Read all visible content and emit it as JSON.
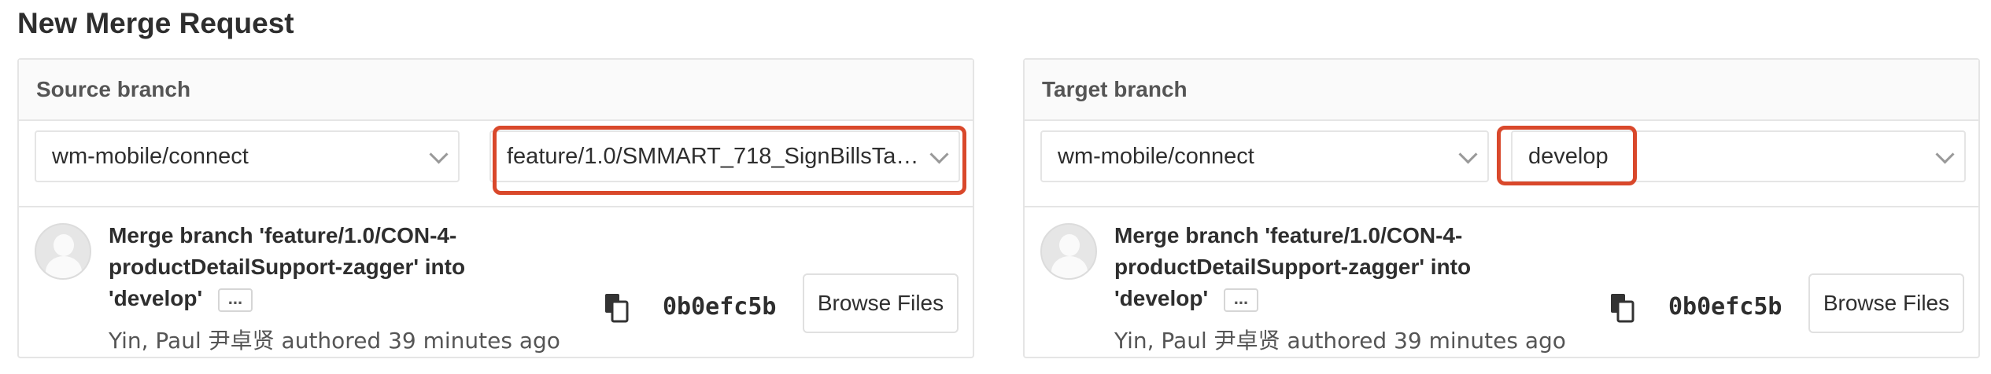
{
  "page": {
    "title": "New Merge Request"
  },
  "source": {
    "header": "Source branch",
    "project": "wm-mobile/connect",
    "branch": "feature/1.0/SMMART_718_SignBillsTab…",
    "commit": {
      "title_lines": [
        "Merge branch 'feature/1.0/CON-4-",
        "productDetailSupport-zagger' into",
        "'develop'"
      ],
      "expand_label": "...",
      "meta": "Yin, Paul 尹卓贤 authored 39 minutes ago",
      "sha": "0b0efc5b",
      "browse_label": "Browse Files"
    }
  },
  "target": {
    "header": "Target branch",
    "project": "wm-mobile/connect",
    "branch": "develop",
    "commit": {
      "title_lines": [
        "Merge branch 'feature/1.0/CON-4-",
        "productDetailSupport-zagger' into",
        "'develop'"
      ],
      "expand_label": "...",
      "meta": "Yin, Paul 尹卓贤 authored 39 minutes ago",
      "sha": "0b0efc5b",
      "browse_label": "Browse Files"
    }
  },
  "colors": {
    "highlight": "#d9482b",
    "border": "#e5e5e5",
    "header_bg": "#fafafa"
  },
  "icons": [
    "chevron-down-icon",
    "copy-icon",
    "avatar-placeholder"
  ]
}
